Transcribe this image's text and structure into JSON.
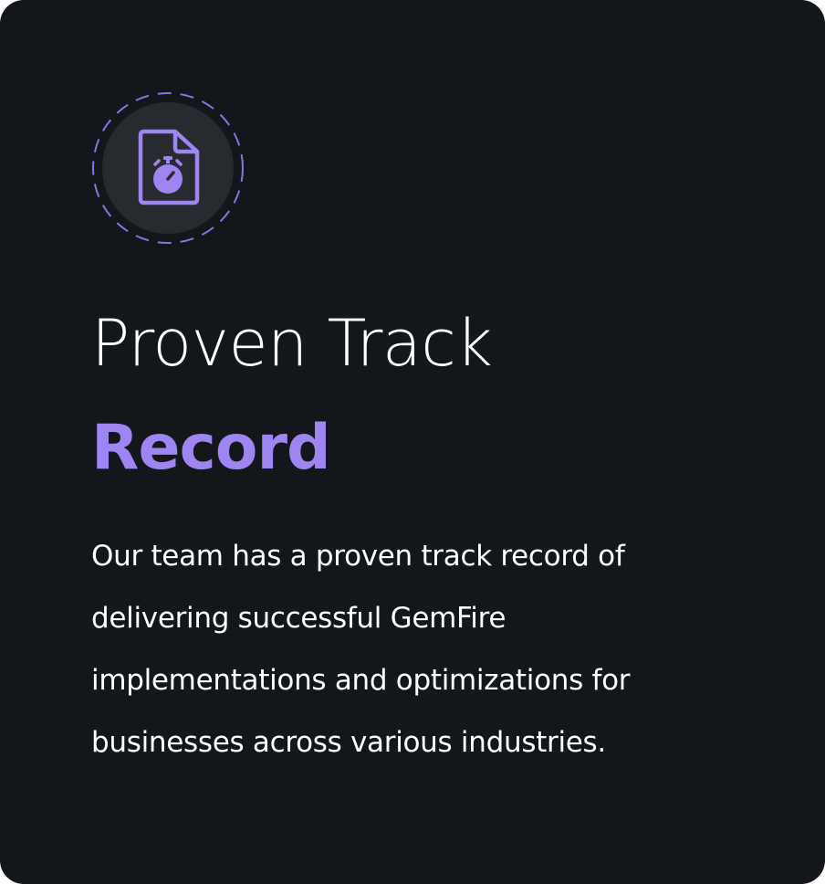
{
  "card": {
    "icon": "document-stopwatch-icon",
    "title_line1": "Proven Track",
    "title_line2": "Record",
    "description": "Our team has a proven track record of delivering successful GemFire implementations and optimizations for businesses across various industries."
  },
  "colors": {
    "background": "#13171b",
    "accent": "#9f85f2",
    "text": "#ffffff",
    "icon_circle": "#272a2f"
  }
}
